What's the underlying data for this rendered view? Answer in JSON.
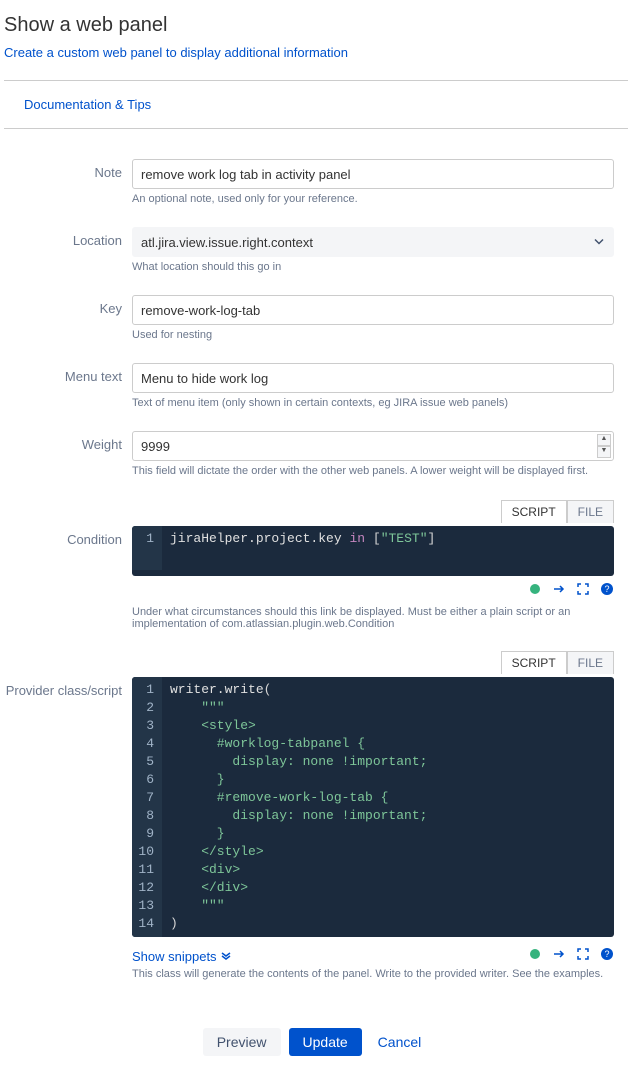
{
  "header": {
    "title": "Show a web panel",
    "subtitle": "Create a custom web panel to display additional information"
  },
  "docs_tips": "Documentation & Tips",
  "fields": {
    "note": {
      "label": "Note",
      "value": "remove work log tab in activity panel",
      "help": "An optional note, used only for your reference."
    },
    "location": {
      "label": "Location",
      "value": "atl.jira.view.issue.right.context",
      "help": "What location should this go in"
    },
    "key": {
      "label": "Key",
      "value": "remove-work-log-tab",
      "help": "Used for nesting"
    },
    "menu_text": {
      "label": "Menu text",
      "value": "Menu to hide work log",
      "help": "Text of menu item (only shown in certain contexts, eg JIRA issue web panels)"
    },
    "weight": {
      "label": "Weight",
      "value": "9999",
      "help": "This field will dictate the order with the other web panels. A lower weight will be displayed first."
    },
    "condition": {
      "label": "Condition",
      "help": "Under what circumstances should this link be displayed. Must be either a plain script or an implementation of com.atlassian.plugin.web.Condition"
    },
    "provider": {
      "label": "Provider class/script",
      "help": "This class will generate the contents of the panel. Write to the provided writer. See the examples."
    }
  },
  "tabs": {
    "script": "SCRIPT",
    "file": "FILE"
  },
  "snippets_link": "Show snippets",
  "buttons": {
    "preview": "Preview",
    "update": "Update",
    "cancel": "Cancel"
  },
  "condition_code": {
    "lines": [
      "1"
    ],
    "text": "jiraHelper.project.key in [\"TEST\"]"
  },
  "provider_code": {
    "lines": [
      "1",
      "2",
      "3",
      "4",
      "5",
      "6",
      "7",
      "8",
      "9",
      "10",
      "11",
      "12",
      "13",
      "14"
    ],
    "l1": "writer.write(",
    "l2": "    \"\"\"",
    "l3": "    <style>",
    "l4": "      #worklog-tabpanel {",
    "l5": "        display: none !important;",
    "l6": "      }",
    "l7": "      #remove-work-log-tab {",
    "l8": "        display: none !important;",
    "l9": "      }",
    "l10": "    </style>",
    "l11": "    <div>",
    "l12": "    </div>",
    "l13": "    \"\"\"",
    "l14": ")"
  }
}
